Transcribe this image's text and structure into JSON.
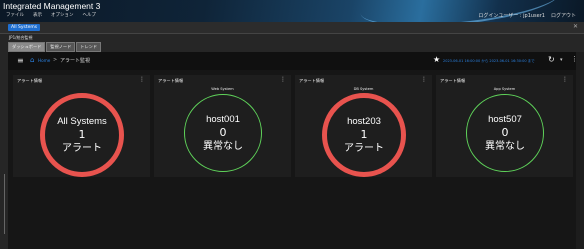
{
  "app": {
    "title": "Integrated Management 3",
    "menu": [
      "ファイル",
      "表示",
      "オプション",
      "ヘルプ"
    ],
    "user_label": "ログインユーザー : jp1user1",
    "logout": "ログアウト"
  },
  "tabs": {
    "active": "All Systems"
  },
  "subbar": {
    "crumb": "JP1/統合監視",
    "subtabs": [
      "ダッシュボード",
      "監視ノード",
      "トレンド"
    ]
  },
  "toolbar": {
    "home_label": "Home",
    "separator": ">",
    "page_title": "アラート監視",
    "time_range": "2023-06-01 16:00:00 から 2023-06-01 16:30:00 まで"
  },
  "cards": [
    {
      "title": "アラート情報",
      "subtitle": "",
      "name": "All Systems",
      "count": "1",
      "state": "アラート",
      "status": "alert"
    },
    {
      "title": "アラート情報",
      "subtitle": "Web System",
      "name": "host001",
      "count": "0",
      "state": "異常なし",
      "status": "ok"
    },
    {
      "title": "アラート情報",
      "subtitle": "DB System",
      "name": "host203",
      "count": "1",
      "state": "アラート",
      "status": "alert"
    },
    {
      "title": "アラート情報",
      "subtitle": "App System",
      "name": "host507",
      "count": "0",
      "state": "異常なし",
      "status": "ok"
    }
  ],
  "colors": {
    "alert": "#e8534e",
    "ok": "#5fd35a",
    "accent": "#2a80e0",
    "tab_active": "#1f6fd0"
  },
  "icons": [
    "hamburger-icon",
    "home-icon",
    "star-icon",
    "refresh-icon",
    "chevron-down-icon",
    "kebab-menu-icon",
    "close-icon"
  ]
}
